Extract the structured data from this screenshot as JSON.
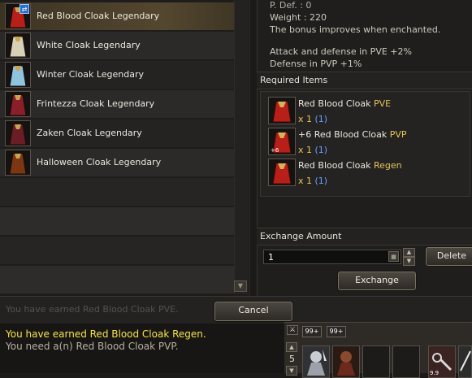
{
  "item_list": [
    {
      "label": "Red Blood Cloak Legendary",
      "icon": "red-blood-cloak-icon",
      "color": "#b81f18",
      "selected": true,
      "has_badge": true
    },
    {
      "label": "White Cloak Legendary",
      "icon": "white-cloak-icon",
      "color": "#d8d1b8",
      "selected": false,
      "has_badge": false
    },
    {
      "label": "Winter Cloak Legendary",
      "icon": "winter-cloak-icon",
      "color": "#8fc4df",
      "selected": false,
      "has_badge": false
    },
    {
      "label": "Frintezza Cloak Legendary",
      "icon": "frintezza-cloak-icon",
      "color": "#8a1f2a",
      "selected": false,
      "has_badge": false
    },
    {
      "label": "Zaken Cloak Legendary",
      "icon": "zaken-cloak-icon",
      "color": "#6a1d25",
      "selected": false,
      "has_badge": false
    },
    {
      "label": "Halloween Cloak Legendary",
      "icon": "halloween-cloak-icon",
      "color": "#7b3614",
      "selected": false,
      "has_badge": false
    }
  ],
  "detail": {
    "pdef": "P. Def. : 0",
    "weight": "Weight : 220",
    "bonus_note": "The bonus improves when enchanted.",
    "effect_1": "Attack and defense in PVE +2%",
    "effect_2": "Defense in PVP +1%"
  },
  "required_items": {
    "title": "Required Items",
    "items": [
      {
        "name": "Red Blood Cloak",
        "variant": "PVE",
        "enchant": "",
        "enchant_tag": "",
        "qty": "x 1",
        "owned": "(1)"
      },
      {
        "name": "+6 Red Blood Cloak",
        "variant": "PVP",
        "enchant": "+6",
        "enchant_tag": "+6",
        "qty": "x 1",
        "owned": "(1)"
      },
      {
        "name": "Red Blood Cloak",
        "variant": "Regen",
        "enchant": "",
        "enchant_tag": "",
        "qty": "x 1",
        "owned": "(1)"
      }
    ]
  },
  "exchange": {
    "amount_label": "Exchange Amount",
    "amount_value": "1",
    "delete_label": "Delete",
    "exchange_label": "Exchange",
    "cancel_label": "Cancel"
  },
  "chat": {
    "faded_line": "You have earned Red Blood Cloak PVE.",
    "line_1": "You have earned Red Blood Cloak Regen.",
    "line_2": "You need a(n) Red Blood Cloak PVP.",
    "line_1_color": "#f3e34a",
    "line_2_color": "#b6b0a4"
  },
  "hotbar": {
    "stack_badge_1": "99+",
    "stack_badge_2": "99+",
    "page_number": "5",
    "slot_count_1": "9.9"
  },
  "colors": {
    "accent_yellow": "#e6c35a",
    "accent_blue": "#6aa0ff"
  }
}
